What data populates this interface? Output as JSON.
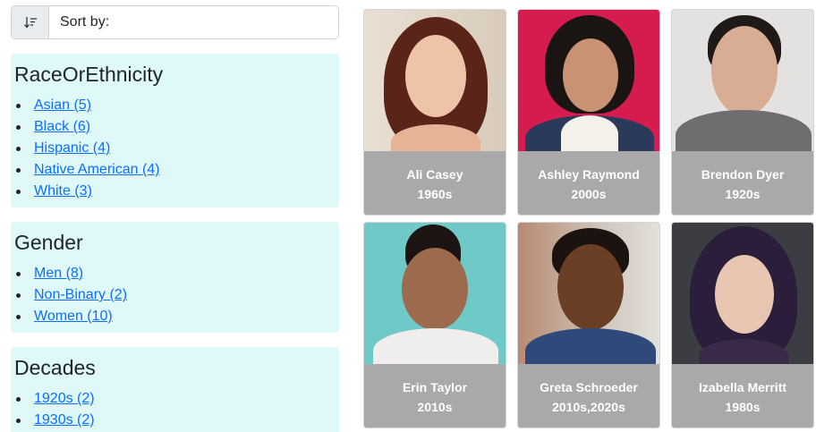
{
  "sort": {
    "label": "Sort by:",
    "icon": "sort-icon"
  },
  "facets": [
    {
      "title": "RaceOrEthnicity",
      "items": [
        "Asian (5)",
        "Black (6)",
        "Hispanic (4)",
        "Native American (4)",
        "White (3)"
      ]
    },
    {
      "title": "Gender",
      "items": [
        "Men (8)",
        "Non-Binary (2)",
        "Women (10)"
      ]
    },
    {
      "title": "Decades",
      "items": [
        "1920s (2)",
        "1930s (2)"
      ]
    }
  ],
  "people": [
    {
      "name": "Ali Casey",
      "decade": "1960s"
    },
    {
      "name": "Ashley Raymond",
      "decade": "2000s"
    },
    {
      "name": "Brendon Dyer",
      "decade": "1920s"
    },
    {
      "name": "Erin Taylor",
      "decade": "2010s"
    },
    {
      "name": "Greta Schroeder",
      "decade": "2010s,2020s"
    },
    {
      "name": "Izabella Merritt",
      "decade": "1980s"
    }
  ],
  "colors": {
    "facet_bg": "#dff8f8",
    "link": "#0d6efd",
    "caption_bg": "#a9a9a9"
  }
}
